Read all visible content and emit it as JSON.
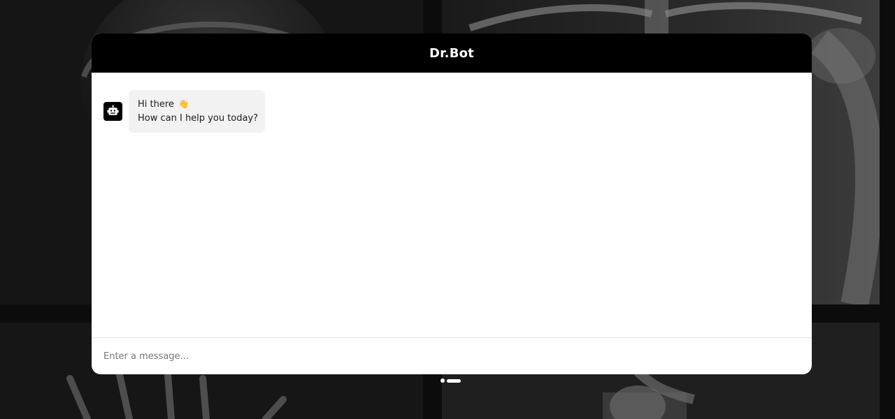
{
  "chat": {
    "title": "Dr.Bot",
    "messages": [
      {
        "sender": "bot",
        "line1": "Hi there",
        "emoji": "👋",
        "line2": "How can I help you today?"
      }
    ],
    "input": {
      "value": "",
      "placeholder": "Enter a message..."
    }
  },
  "icons": {
    "avatar": "robot-icon"
  },
  "colors": {
    "header_bg": "#000000",
    "chat_bg": "#ffffff",
    "bubble_bg": "#f2f2f2",
    "page_bg": "#0c0c0c"
  },
  "carousel": {
    "slides": 2,
    "active": 2
  }
}
